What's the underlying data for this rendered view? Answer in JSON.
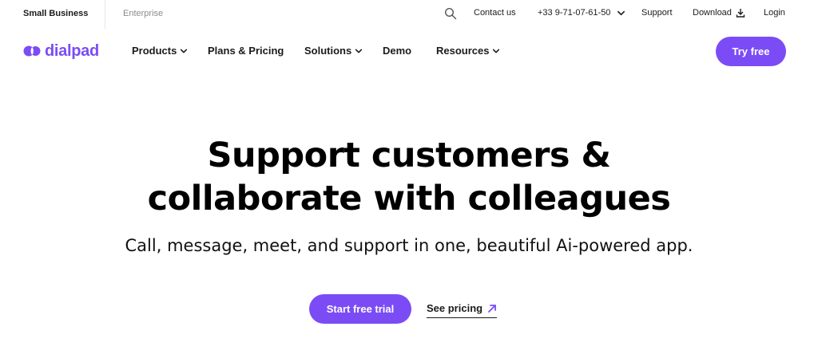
{
  "utility_bar": {
    "segments": [
      "Small Business",
      "Enterprise"
    ],
    "contact_label": "Contact us",
    "phone": "+33 9-71-07-61-50",
    "support_label": "Support",
    "download_label": "Download",
    "login_label": "Login",
    "icons": [
      "search-icon",
      "chevron-down-icon",
      "download-icon"
    ]
  },
  "nav": {
    "logo_text": "dialpad",
    "items": [
      {
        "label": "Products",
        "has_dropdown": true
      },
      {
        "label": "Plans & Pricing",
        "has_dropdown": false
      },
      {
        "label": "Solutions",
        "has_dropdown": true
      },
      {
        "label": "Demo",
        "has_dropdown": false
      },
      {
        "label": "Resources",
        "has_dropdown": true
      }
    ],
    "cta_label": "Try free"
  },
  "hero": {
    "title_line1": "Support customers &",
    "title_line2": "collaborate with colleagues",
    "subtitle": "Call, message, meet, and support in one, beautiful Ai-powered app.",
    "primary_cta": "Start free trial",
    "secondary_cta": "See pricing"
  },
  "colors": {
    "brand": "#7b4cf5",
    "text": "#1b1b1b",
    "muted": "#8c8c8c",
    "background": "#ffffff"
  }
}
